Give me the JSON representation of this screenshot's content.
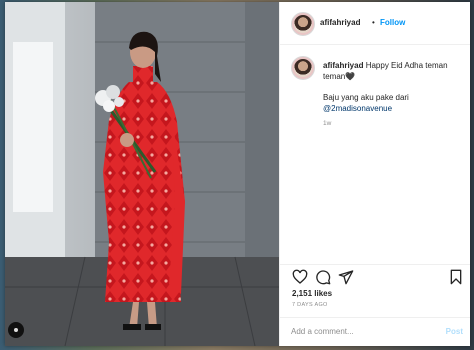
{
  "post": {
    "username": "afifahriyad",
    "follow_label": "Follow",
    "separator": "•",
    "caption_line1": "Happy Eid Adha teman teman🖤",
    "caption_line2": "Baju yang aku pake dari",
    "caption_mention": "@2madisonavenue",
    "relative_time": "1w",
    "likes": "2,151 likes",
    "date": "7 DAYS AGO"
  },
  "comment": {
    "placeholder": "Add a comment...",
    "post_label": "Post"
  },
  "icons": {
    "like": "heart-icon",
    "comment": "comment-icon",
    "share": "share-icon",
    "save": "bookmark-icon"
  },
  "colors": {
    "link": "#0095f6",
    "dress": "#e0282b",
    "post_disabled": "#b2dffc"
  }
}
